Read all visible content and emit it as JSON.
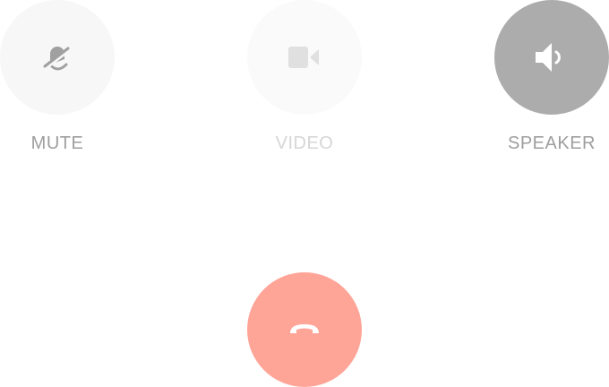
{
  "controls": {
    "mute": {
      "label": "MUTE",
      "icon": "mic-off-icon",
      "state": "inactive"
    },
    "video": {
      "label": "VIDEO",
      "icon": "video-camera-icon",
      "state": "disabled"
    },
    "speaker": {
      "label": "SPEAKER",
      "icon": "speaker-icon",
      "state": "active"
    }
  },
  "end_call": {
    "icon": "hang-up-icon"
  },
  "colors": {
    "inactive_bg": "#f7f7f7",
    "disabled_bg": "#fafafa",
    "active_bg": "#acacac",
    "label": "#9e9e9e",
    "label_disabled": "#d6d6d6",
    "end_call_bg": "#ffa598",
    "icon_inactive": "#a0a0a0",
    "icon_disabled": "#e0e0e0",
    "icon_active": "#ffffff"
  }
}
